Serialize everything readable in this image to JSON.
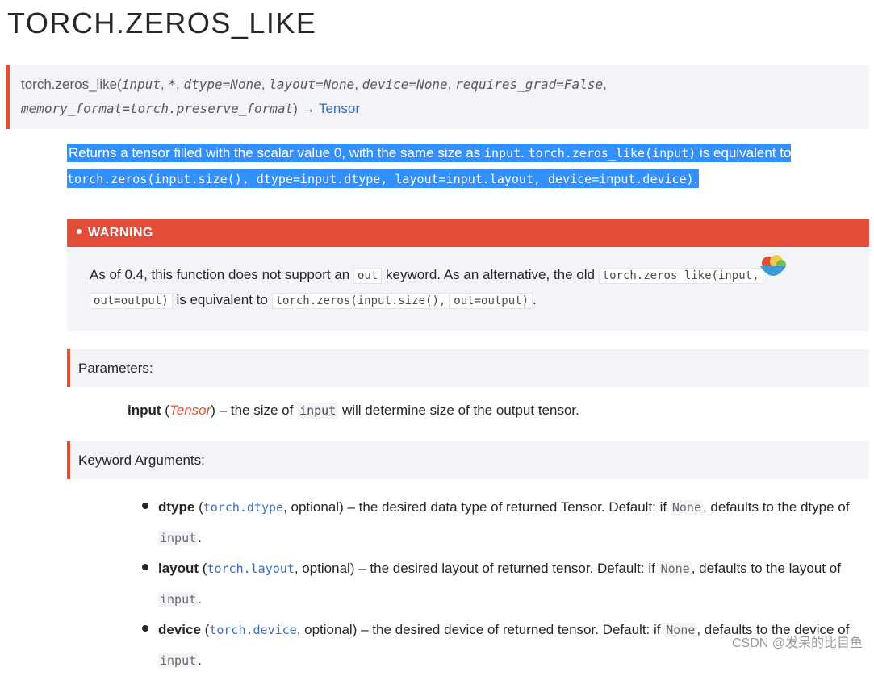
{
  "title": "TORCH.ZEROS_LIKE",
  "signature": {
    "name": "torch.zeros_like(",
    "p_input": "input",
    "sep1": ", ",
    "p_star": "*",
    "sep2": ", ",
    "p_dtype": "dtype=None",
    "sep3": ", ",
    "p_layout": "layout=None",
    "sep4": ", ",
    "p_device": "device=None",
    "sep5": ", ",
    "p_requires_grad": "requires_grad=False",
    "sep6": ",",
    "p_memory_format": "memory_format=torch.preserve_format",
    "close": ")",
    "arrow": " → ",
    "return_type": "Tensor"
  },
  "description": {
    "part1": "Returns a tensor filled with the scalar value 0, with the same size as ",
    "code1": "input",
    "part2": ". ",
    "code2": "torch.zeros_like(input)",
    "part3": " is equivalent to ",
    "code3": "torch.zeros(input.size(), dtype=input.dtype, layout=input.layout, device=input.device)",
    "part4": "."
  },
  "warning": {
    "label": "WARNING",
    "text1": "As of 0.4, this function does not support an ",
    "code1": "out",
    "text2": " keyword. As an alternative, the old ",
    "code2": "torch.zeros_like(input,",
    "code3": "out=output)",
    "text3": " is equivalent to ",
    "code4": "torch.zeros(input.size(),",
    "code5": "out=output)",
    "text4": "."
  },
  "parameters": {
    "header": "Parameters:",
    "name": "input",
    "open": " (",
    "type": "Tensor",
    "close": ")",
    "dash_text": " – the size of ",
    "code": "input",
    "rest": " will determine size of the output tensor."
  },
  "keyword_args": {
    "header": "Keyword Arguments:",
    "items": [
      {
        "name": "dtype",
        "type_link": "torch.dtype",
        "optional": ", optional)",
        "text1": " – the desired data type of returned Tensor. Default: if ",
        "none": "None",
        "text2": ", defaults to the dtype of ",
        "code": "input",
        "end": "."
      },
      {
        "name": "layout",
        "type_link": "torch.layout",
        "optional": ", optional)",
        "text1": " – the desired layout of returned tensor. Default: if ",
        "none": "None",
        "text2": ", defaults to the layout of ",
        "code": "input",
        "end": "."
      },
      {
        "name": "device",
        "type_link": "torch.device",
        "optional": ", optional)",
        "text1": " – the desired device of returned tensor. Default: if ",
        "none": "None",
        "text2": ", defaults to the device of ",
        "code": "input",
        "end": "."
      }
    ]
  },
  "watermark": "CSDN @发呆的比目鱼"
}
